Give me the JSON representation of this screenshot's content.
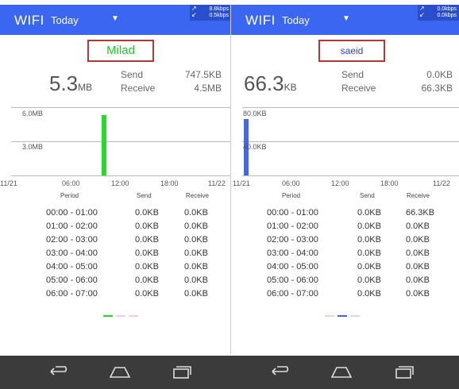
{
  "left": {
    "app_name": "WIFI",
    "period": "Today",
    "speed_up": "8.8kbps",
    "speed_down": "0.5kbps",
    "name": "Milad",
    "name_color": "#22c32b",
    "total_value": "5.3",
    "total_unit": "MB",
    "send_label": "Send",
    "receive_label": "Receive",
    "send_value": "747.5KB",
    "receive_value": "4.5MB",
    "chart_data": {
      "type": "bar",
      "y_ticks": [
        "6.0MB",
        "3.0MB"
      ],
      "x_ticks": [
        "11/21",
        "06:00",
        "12:00",
        "18:00",
        "11/22"
      ],
      "bars": [
        {
          "start_hour": 10.5,
          "end_hour": 11,
          "value_mb": 5.3,
          "color": "#22dd22"
        }
      ],
      "ylim_mb": [
        0,
        6.0
      ]
    },
    "table": {
      "headers": [
        "Period",
        "Send",
        "Receive"
      ],
      "rows": [
        [
          "00:00 - 01:00",
          "0.0KB",
          "0.0KB"
        ],
        [
          "01:00 - 02:00",
          "0.0KB",
          "0.0KB"
        ],
        [
          "02:00 - 03:00",
          "0.0KB",
          "0.0KB"
        ],
        [
          "03:00 - 04:00",
          "0.0KB",
          "0.0KB"
        ],
        [
          "04:00 - 05:00",
          "0.0KB",
          "0.0KB"
        ],
        [
          "05:00 - 06:00",
          "0.0KB",
          "0.0KB"
        ],
        [
          "06:00 - 07:00",
          "0.0KB",
          "0.0KB"
        ]
      ]
    }
  },
  "right": {
    "app_name": "WIFI",
    "period": "Today",
    "speed_up": "0.0kbps",
    "speed_down": "0.0kbps",
    "name": "saeid",
    "name_color": "#3340cc",
    "total_value": "66.3",
    "total_unit": "KB",
    "send_label": "Send",
    "receive_label": "Receive",
    "send_value": "0.0KB",
    "receive_value": "66.3KB",
    "chart_data": {
      "type": "bar",
      "y_ticks": [
        "80.0KB",
        "40.0KB"
      ],
      "x_ticks": [
        "11/21",
        "06:00",
        "12:00",
        "18:00",
        "11/22"
      ],
      "bars": [
        {
          "start_hour": 0,
          "end_hour": 0.5,
          "value_kb": 66.3,
          "color": "#4466ee"
        }
      ],
      "ylim_kb": [
        0,
        80.0
      ]
    },
    "table": {
      "headers": [
        "Period",
        "Send",
        "Receive"
      ],
      "rows": [
        [
          "00:00 - 01:00",
          "0.0KB",
          "66.3KB"
        ],
        [
          "01:00 - 02:00",
          "0.0KB",
          "0.0KB"
        ],
        [
          "02:00 - 03:00",
          "0.0KB",
          "0.0KB"
        ],
        [
          "03:00 - 04:00",
          "0.0KB",
          "0.0KB"
        ],
        [
          "04:00 - 05:00",
          "0.0KB",
          "0.0KB"
        ],
        [
          "05:00 - 06:00",
          "0.0KB",
          "0.0KB"
        ],
        [
          "06:00 - 07:00",
          "0.0KB",
          "0.0KB"
        ]
      ]
    }
  },
  "colors": {
    "toolbar": "#3a66f0",
    "navbar": "#3b3b3b",
    "name_border": "#b03a3a"
  }
}
